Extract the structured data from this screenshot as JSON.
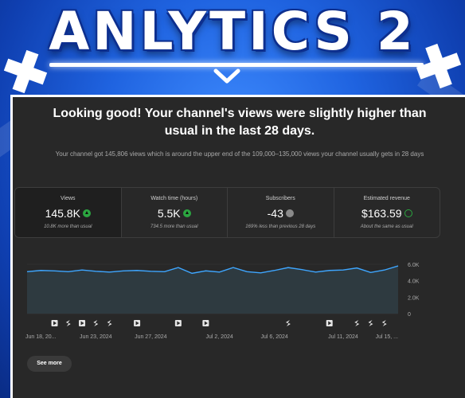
{
  "banner": {
    "title": "ANLYTICS 2"
  },
  "summary": {
    "headline": "Looking good! Your channel's views were slightly higher than usual in the last 28 days.",
    "subtext": "Your channel got 145,806 views which is around the upper end of the 109,000–135,000 views your channel usually gets in 28 days"
  },
  "metrics": [
    {
      "label": "Views",
      "value": "145.8K",
      "status_icon": "arrow-up-icon",
      "note": "10.8K more than usual"
    },
    {
      "label": "Watch time (hours)",
      "value": "5.5K",
      "status_icon": "arrow-up-icon",
      "note": "734.5 more than usual"
    },
    {
      "label": "Subscribers",
      "value": "-43",
      "status_icon": "info-icon",
      "note": "169% less than previous 28 days"
    },
    {
      "label": "Estimated revenue",
      "value": "$163.59",
      "status_icon": "check-icon",
      "note": "About the same as usual"
    }
  ],
  "colors": {
    "accent_line": "#3ea6ff",
    "positive": "#2ba640",
    "panel_bg": "#282828",
    "banner_blue": "#1f63e0"
  },
  "chart_data": {
    "type": "area",
    "series": [
      {
        "values": [
          5100,
          5250,
          5200,
          5100,
          5300,
          5150,
          5050,
          5200,
          5250,
          5150,
          5100,
          5600,
          4900,
          5200,
          5050,
          5600,
          5100,
          4950,
          5250,
          5600,
          5350,
          5050,
          5250,
          5300,
          5550,
          5000,
          5300,
          5800
        ]
      }
    ],
    "x_tick_labels": [
      "Jun 18, 20...",
      "Jun 23, 2024",
      "Jun 27, 2024",
      "Jul 2, 2024",
      "Jul 6, 2024",
      "Jul 11, 2024",
      "Jul 15, ..."
    ],
    "y_tick_labels": [
      "6.0K",
      "4.0K",
      "2.0K",
      "0"
    ],
    "ylim": [
      0,
      6000
    ],
    "grid": true,
    "event_markers": [
      {
        "day": 2,
        "icon": "video-icon"
      },
      {
        "day": 3,
        "icon": "shorts-icon"
      },
      {
        "day": 4,
        "icon": "video-icon"
      },
      {
        "day": 5,
        "icon": "shorts-icon"
      },
      {
        "day": 6,
        "icon": "shorts-icon"
      },
      {
        "day": 8,
        "icon": "video-icon"
      },
      {
        "day": 11,
        "icon": "video-icon"
      },
      {
        "day": 13,
        "icon": "video-icon"
      },
      {
        "day": 19,
        "icon": "shorts-icon"
      },
      {
        "day": 22,
        "icon": "video-icon"
      },
      {
        "day": 24,
        "icon": "shorts-icon"
      },
      {
        "day": 25,
        "icon": "shorts-icon"
      },
      {
        "day": 26,
        "icon": "shorts-icon"
      }
    ]
  },
  "actions": {
    "see_more": "See more"
  }
}
